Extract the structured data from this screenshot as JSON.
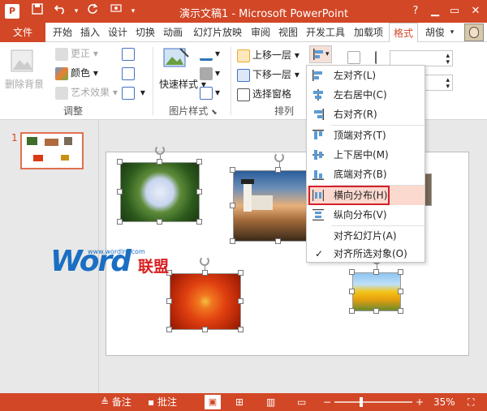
{
  "titlebar": {
    "app_icon": "P",
    "title": "演示文稿1 - Microsoft PowerPoint",
    "icons": [
      "powerpoint-icon",
      "save-icon",
      "undo-icon",
      "redo-icon",
      "customize-icon",
      "help-icon",
      "minimize-icon",
      "restore-icon",
      "close-icon"
    ]
  },
  "tabs": [
    "文件",
    "开始",
    "插入",
    "设计",
    "切换",
    "动画",
    "幻灯片放映",
    "审阅",
    "视图",
    "开发工具",
    "加载项",
    "格式",
    "胡俊"
  ],
  "active_tab": "格式",
  "ribbon": {
    "adjust": {
      "remove_bg": "删除背景",
      "corrections": "更正",
      "color": "颜色",
      "artistic": "艺术效果",
      "label": "调整"
    },
    "picture_styles": {
      "quick_styles": "快速样式",
      "label": "图片样式"
    },
    "arrange": {
      "bring_forward": "上移一层",
      "send_backward": "下移一层",
      "selection_pane": "选择窗格",
      "label": "排列"
    }
  },
  "align_menu": {
    "items": [
      {
        "label": "左对齐(L)",
        "icon": "align-left-icon"
      },
      {
        "label": "左右居中(C)",
        "icon": "align-center-icon"
      },
      {
        "label": "右对齐(R)",
        "icon": "align-right-icon"
      },
      {
        "label": "顶端对齐(T)",
        "icon": "align-top-icon"
      },
      {
        "label": "上下居中(M)",
        "icon": "align-middle-icon"
      },
      {
        "label": "底端对齐(B)",
        "icon": "align-bottom-icon"
      },
      {
        "label": "横向分布(H)",
        "icon": "distribute-horizontal-icon",
        "highlighted": true
      },
      {
        "label": "纵向分布(V)",
        "icon": "distribute-vertical-icon"
      },
      {
        "label": "对齐幻灯片(A)",
        "icon": ""
      },
      {
        "label": "对齐所选对象(O)",
        "icon": "",
        "checked": true
      }
    ]
  },
  "thumbnail": {
    "number": "1"
  },
  "watermark": {
    "url": "www.wordlm.com",
    "logo": "Word",
    "cn": "联盟"
  },
  "statusbar": {
    "notes": "备注",
    "comments": "批注",
    "zoom": "35%",
    "zoom_level": 0.35,
    "minus": "−",
    "plus": "+"
  },
  "colors": {
    "accent": "#d24726",
    "highlight_bg": "#fcd9cf",
    "highlight_border": "#d3202a",
    "link_blue": "#1a6fc2"
  }
}
